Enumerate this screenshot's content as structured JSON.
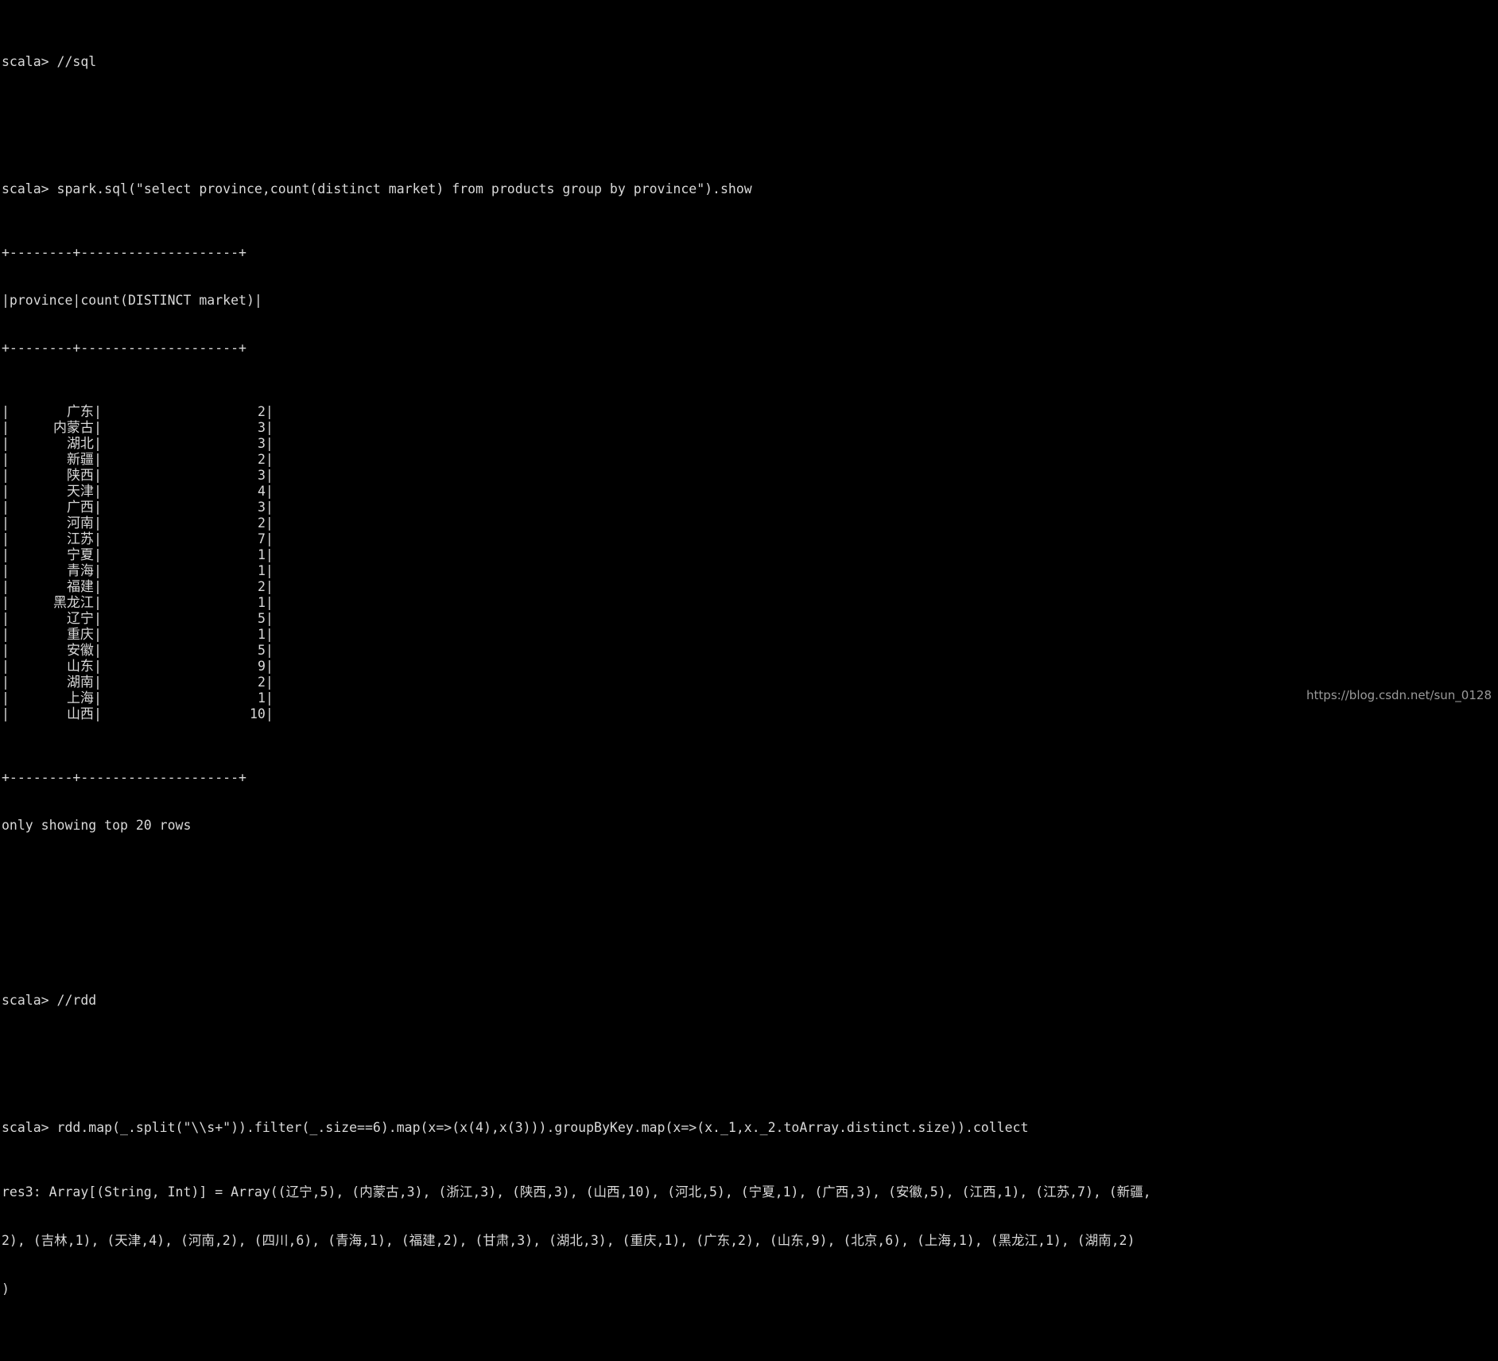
{
  "terminal": {
    "prompt": "scala> ",
    "background_color": "#000000",
    "text_color": "#d9d9d9"
  },
  "commands": {
    "sql_comment": "//sql",
    "sql_query": "spark.sql(\"select province,count(distinct market) from products group by province\").show",
    "rdd_comment": "//rdd",
    "rdd_query": "rdd.map(_.split(\"\\\\s+\")).filter(_.size==6).map(x=>(x(4),x(3))).groupByKey.map(x=>(x._1,x._2.toArray.distinct.size)).collect"
  },
  "table": {
    "border": "+--------+--------------------+",
    "header_row": "|province|count(DISTINCT market)|",
    "headers": [
      "province",
      "count(DISTINCT market)"
    ],
    "rows": [
      {
        "province": "广东",
        "count": "2"
      },
      {
        "province": "内蒙古",
        "count": "3"
      },
      {
        "province": "湖北",
        "count": "3"
      },
      {
        "province": "新疆",
        "count": "2"
      },
      {
        "province": "陕西",
        "count": "3"
      },
      {
        "province": "天津",
        "count": "4"
      },
      {
        "province": "广西",
        "count": "3"
      },
      {
        "province": "河南",
        "count": "2"
      },
      {
        "province": "江苏",
        "count": "7"
      },
      {
        "province": "宁夏",
        "count": "1"
      },
      {
        "province": "青海",
        "count": "1"
      },
      {
        "province": "福建",
        "count": "2"
      },
      {
        "province": "黑龙江",
        "count": "1"
      },
      {
        "province": "辽宁",
        "count": "5"
      },
      {
        "province": "重庆",
        "count": "1"
      },
      {
        "province": "安徽",
        "count": "5"
      },
      {
        "province": "山东",
        "count": "9"
      },
      {
        "province": "湖南",
        "count": "2"
      },
      {
        "province": "上海",
        "count": "1"
      },
      {
        "province": "山西",
        "count": "10"
      }
    ],
    "footer_note": "only showing top 20 rows"
  },
  "result": {
    "label": "res3: Array[(String, Int)] = Array(",
    "line1": "res3: Array[(String, Int)] = Array((辽宁,5), (内蒙古,3), (浙江,3), (陕西,3), (山西,10), (河北,5), (宁夏,1), (广西,3), (安徽,5), (江西,1), (江苏,7), (新疆,",
    "line2": "2), (吉林,1), (天津,4), (河南,2), (四川,6), (青海,1), (福建,2), (甘肃,3), (湖北,3), (重庆,1), (广东,2), (山东,9), (北京,6), (上海,1), (黑龙江,1), (湖南,2)",
    "line3": ")",
    "pairs": [
      {
        "province": "辽宁",
        "count": 5
      },
      {
        "province": "内蒙古",
        "count": 3
      },
      {
        "province": "浙江",
        "count": 3
      },
      {
        "province": "陕西",
        "count": 3
      },
      {
        "province": "山西",
        "count": 10
      },
      {
        "province": "河北",
        "count": 5
      },
      {
        "province": "宁夏",
        "count": 1
      },
      {
        "province": "广西",
        "count": 3
      },
      {
        "province": "安徽",
        "count": 5
      },
      {
        "province": "江西",
        "count": 1
      },
      {
        "province": "江苏",
        "count": 7
      },
      {
        "province": "新疆",
        "count": 2
      },
      {
        "province": "吉林",
        "count": 1
      },
      {
        "province": "天津",
        "count": 4
      },
      {
        "province": "河南",
        "count": 2
      },
      {
        "province": "四川",
        "count": 6
      },
      {
        "province": "青海",
        "count": 1
      },
      {
        "province": "福建",
        "count": 2
      },
      {
        "province": "甘肃",
        "count": 3
      },
      {
        "province": "湖北",
        "count": 3
      },
      {
        "province": "重庆",
        "count": 1
      },
      {
        "province": "广东",
        "count": 2
      },
      {
        "province": "山东",
        "count": 9
      },
      {
        "province": "北京",
        "count": 6
      },
      {
        "province": "上海",
        "count": 1
      },
      {
        "province": "黑龙江",
        "count": 1
      },
      {
        "province": "湖南",
        "count": 2
      }
    ]
  },
  "watermark": "https://blog.csdn.net/sun_0128"
}
